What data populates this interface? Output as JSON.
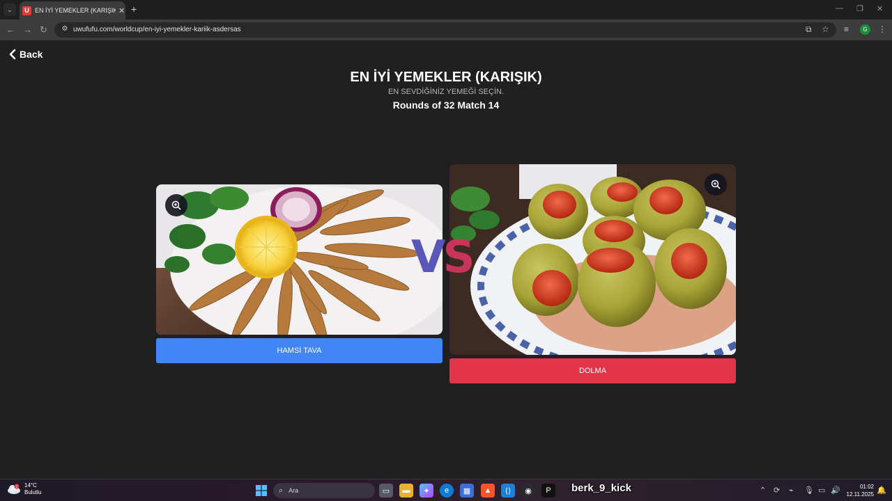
{
  "browser": {
    "tab_title": "EN İYİ YEMEKLER (KARIŞIK) | Uw",
    "tab_favicon_letter": "U",
    "url": "uwufufu.com/worldcup/en-iyi-yemekler-kariik-asdersas",
    "profile_initial": "G"
  },
  "page": {
    "back_label": "Back",
    "title": "EN İYİ YEMEKLER (KARIŞIK)",
    "subtitle": "EN SEVDİĞİNİZ YEMEĞİ SEÇİN.",
    "round_label": "Rounds of 32 Match 14",
    "vs_text": "VS",
    "left_choice": {
      "name": "HAMSİ TAVA",
      "button_color": "#4285f4"
    },
    "right_choice": {
      "name": "DOLMA",
      "button_color": "#e4344a"
    }
  },
  "taskbar": {
    "weather_temp": "14°C",
    "weather_desc": "Bulutlu",
    "weather_badge": "1",
    "search_placeholder": "Ara",
    "stream_overlay": "berk_9_kick",
    "time": "01:02",
    "date": "12.11.2025"
  }
}
